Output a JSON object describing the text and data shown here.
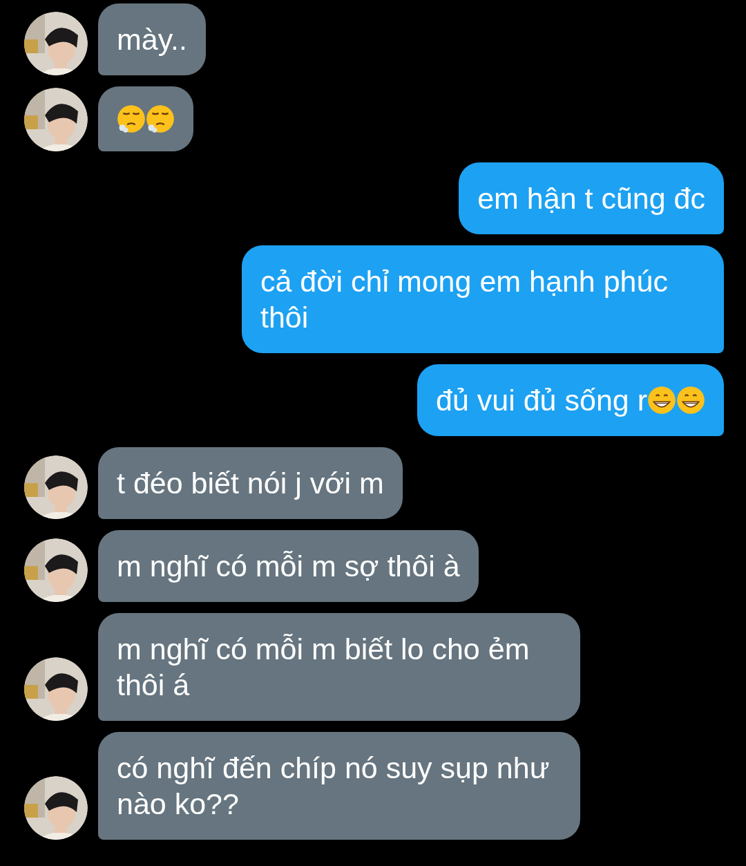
{
  "messages": [
    {
      "kind": "received",
      "text": "mày.."
    },
    {
      "kind": "received",
      "emoji": [
        {
          "kind": "exhale"
        },
        {
          "kind": "exhale"
        }
      ]
    },
    {
      "kind": "sent",
      "text": "em hận t cũng đc"
    },
    {
      "kind": "sent",
      "text": "cả đời chỉ mong em hạnh phúc thôi"
    },
    {
      "kind": "sent",
      "text": "đủ vui đủ sống r",
      "emoji": [
        {
          "kind": "grin"
        },
        {
          "kind": "grin"
        }
      ]
    },
    {
      "kind": "received",
      "text": "t đéo biết nói j với m"
    },
    {
      "kind": "received",
      "text": "m nghĩ có mỗi m sợ thôi à"
    },
    {
      "kind": "received",
      "text": "m nghĩ có mỗi m biết lo cho ẻm thôi á"
    },
    {
      "kind": "received",
      "text": "có nghĩ đến chíp nó suy sụp như nào ko??"
    }
  ]
}
